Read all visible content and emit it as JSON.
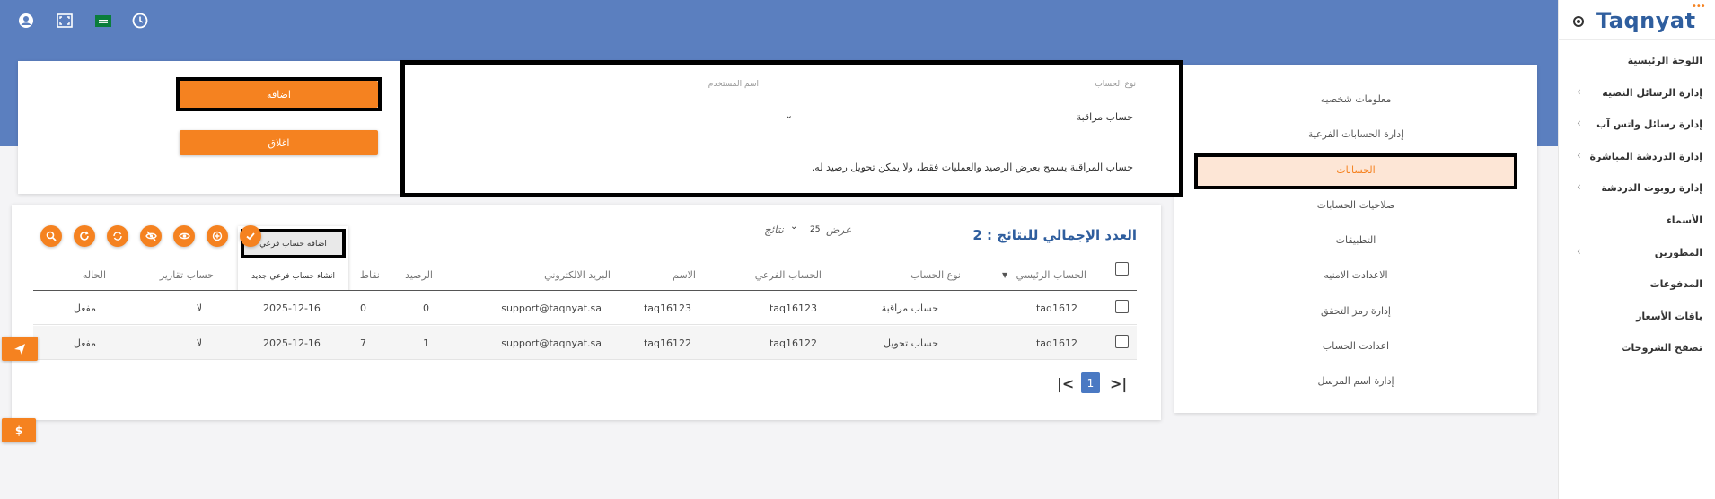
{
  "sidebar": {
    "logo": "Taqnyat",
    "items": [
      {
        "label": "اللوحة الرئيسية",
        "chevron": false
      },
      {
        "label": "إدارة الرسائل النصيه",
        "chevron": true
      },
      {
        "label": "إدارة رسائل واتس آب",
        "chevron": true
      },
      {
        "label": "إدارة الدردشة المباشرة",
        "chevron": true
      },
      {
        "label": "إدارة روبوت الدردشة",
        "chevron": true
      },
      {
        "label": "الأسماء",
        "chevron": false
      },
      {
        "label": "المطورين",
        "chevron": true
      },
      {
        "label": "المدفوعات",
        "chevron": false
      },
      {
        "label": "باقات الأسعار",
        "chevron": false
      },
      {
        "label": "تصفح الشروحات",
        "chevron": false
      }
    ]
  },
  "settings_menu": {
    "items": [
      "معلومات شخصيه",
      "إدارة الحسابات الفرعية",
      "الحسابات",
      "صلاحيات الحسابات",
      "التطبيقات",
      "الاعدادت الامنيه",
      "إدارة رمز التحقق",
      "اعدادت الحساب",
      "إدارة اسم المرسل"
    ],
    "active_index": 2
  },
  "form": {
    "account_type_label": "نوع الحساب",
    "account_type_value": "حساب مراقبة",
    "username_label": "اسم المستخدم",
    "username_value": "",
    "note": "حساب المراقبة يسمح بعرض الرصيد والعمليات فقط، ولا يمكن تحويل رصيد له.",
    "add_button": "اضافه",
    "close_button": "اغلاق"
  },
  "results": {
    "title": "العدد الإجمالي للنتائج : 2",
    "show_label": "عرض",
    "page_size": "25",
    "results_label": "نتائج",
    "dropdown_add": "اضافه حساب فرعي",
    "dropdown_create": "انشاء حساب فرعي جديد"
  },
  "table": {
    "headers": {
      "main_account": "الحساب الرئيسي",
      "account_type": "نوع الحساب",
      "sub_account": "الحساب الفرعي",
      "name": "الاسم",
      "email": "البريد الالكتروني",
      "balance": "الرصيد",
      "points": "نقاط",
      "reports_account": "حساب تقارير",
      "status": "الحاله"
    },
    "rows": [
      {
        "main_account": "taq1612",
        "account_type": "حساب مراقبة",
        "sub_account": "taq16123",
        "name": "taq16123",
        "email": "support@taqnyat.sa",
        "balance": "0",
        "points": "0",
        "date": "2025-12-16",
        "reports_account": "لا",
        "status": "مفعل"
      },
      {
        "main_account": "taq1612",
        "account_type": "حساب تحويل",
        "sub_account": "taq16122",
        "name": "taq16122",
        "email": "support@taqnyat.sa",
        "balance": "1",
        "points": "7",
        "date": "2025-12-16",
        "reports_account": "لا",
        "status": "مفعل"
      }
    ]
  },
  "pagination": {
    "current_page": "1"
  },
  "icons": {
    "top_bar": [
      "user-circle-icon",
      "fullscreen-icon",
      "saudi-flag-icon",
      "clock-icon"
    ],
    "actions": [
      "search-icon",
      "refresh-icon",
      "sync-icon",
      "eye-off-icon",
      "eye-icon",
      "plus-circle-icon",
      "check-icon"
    ],
    "side_actions": [
      "send-icon",
      "dollar-icon"
    ]
  },
  "colors": {
    "accent": "#f58220",
    "header_blue": "#5b7fbf",
    "brand": "#2f5e9e",
    "title_blue": "#2f5e9e",
    "page_badge": "#4a79c3"
  }
}
